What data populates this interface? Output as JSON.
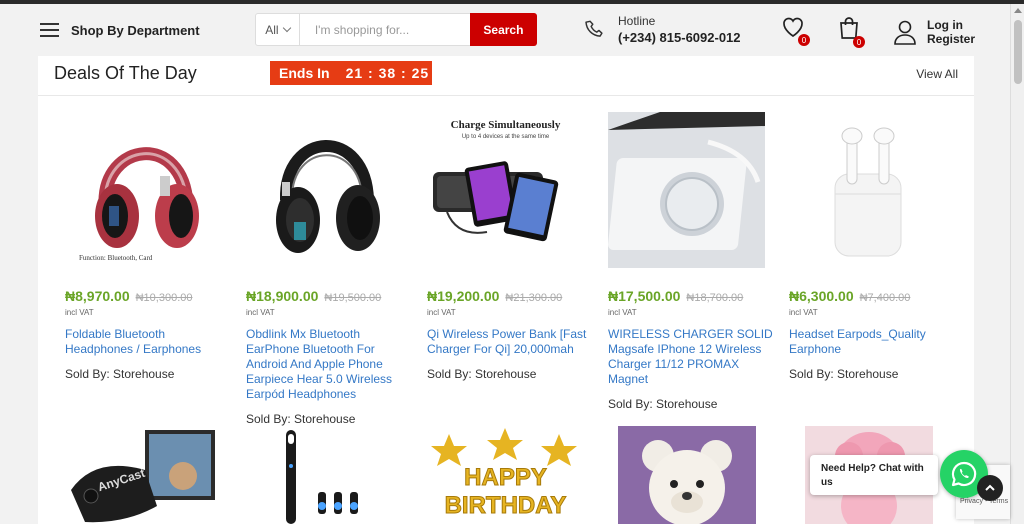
{
  "header": {
    "department_label": "Shop By Department",
    "search": {
      "category": "All",
      "placeholder": "I'm shopping for...",
      "button_label": "Search"
    },
    "hotline": {
      "label": "Hotline",
      "number": "(+234) 815-6092-012"
    },
    "wishlist_count": "0",
    "cart_count": "0",
    "account": {
      "login": "Log in",
      "register": "Register"
    },
    "brand_color": "#cc0000"
  },
  "deals": {
    "title": "Deals Of The Day",
    "ends_label": "Ends In",
    "countdown": "21 : 38 : 25",
    "view_all": "View All",
    "products": [
      {
        "name": "Foldable Bluetooth Headphones / Earphones",
        "price": "₦8,970.00",
        "old_price": "₦10,300.00",
        "vat": "incl VAT",
        "sold_by": "Sold By: Storehouse",
        "image_caption": "Function: Bluetooth, Card",
        "image": "red-headphones"
      },
      {
        "name": "Obdlink Mx Bluetooth EarPhone Bluetooth For Android And Apple Phone Earpiece Hear 5.0 Wireless Earpód Headphones",
        "price": "₦18,900.00",
        "old_price": "₦19,500.00",
        "vat": "incl VAT",
        "sold_by": "Sold By: Storehouse",
        "image": "black-headphones"
      },
      {
        "name": "Qi Wireless Power Bank [Fast Charger For Qi] 20,000mah",
        "price": "₦19,200.00",
        "old_price": "₦21,300.00",
        "vat": "incl VAT",
        "sold_by": "Sold By: Storehouse",
        "image_title": "Charge Simultaneously",
        "image_subtitle": "Up to 4 devices at the same time",
        "image": "power-bank"
      },
      {
        "name": "WIRELESS CHARGER SOLID Magsafe IPhone 12 Wireless Charger 11/12 PROMAX Magnet",
        "price": "₦17,500.00",
        "old_price": "₦18,700.00",
        "vat": "incl VAT",
        "sold_by": "Sold By: Storehouse",
        "image": "magsafe-charger"
      },
      {
        "name": "Headset Earpods_Quality Earphone",
        "price": "₦6,300.00",
        "old_price": "₦7,400.00",
        "vat": "incl VAT",
        "sold_by": "Sold By: Storehouse",
        "image": "white-earpods"
      }
    ],
    "second_row": [
      {
        "image": "chromecast-dongle",
        "image_text": "AnyCast"
      },
      {
        "image": "electric-toothbrush"
      },
      {
        "image": "birthday-balloons",
        "image_text_1": "HAPPY",
        "image_text_2": "BIRTHDAY"
      },
      {
        "image": "teddy-bear"
      },
      {
        "image": "pink-teddy"
      }
    ]
  },
  "chat": {
    "text": "Need Help? Chat with us"
  },
  "recaptcha": {
    "text": "Privacy - Terms"
  },
  "price_color": "#6aa527",
  "link_color": "#3478c6",
  "countdown_color": "#e63c14"
}
